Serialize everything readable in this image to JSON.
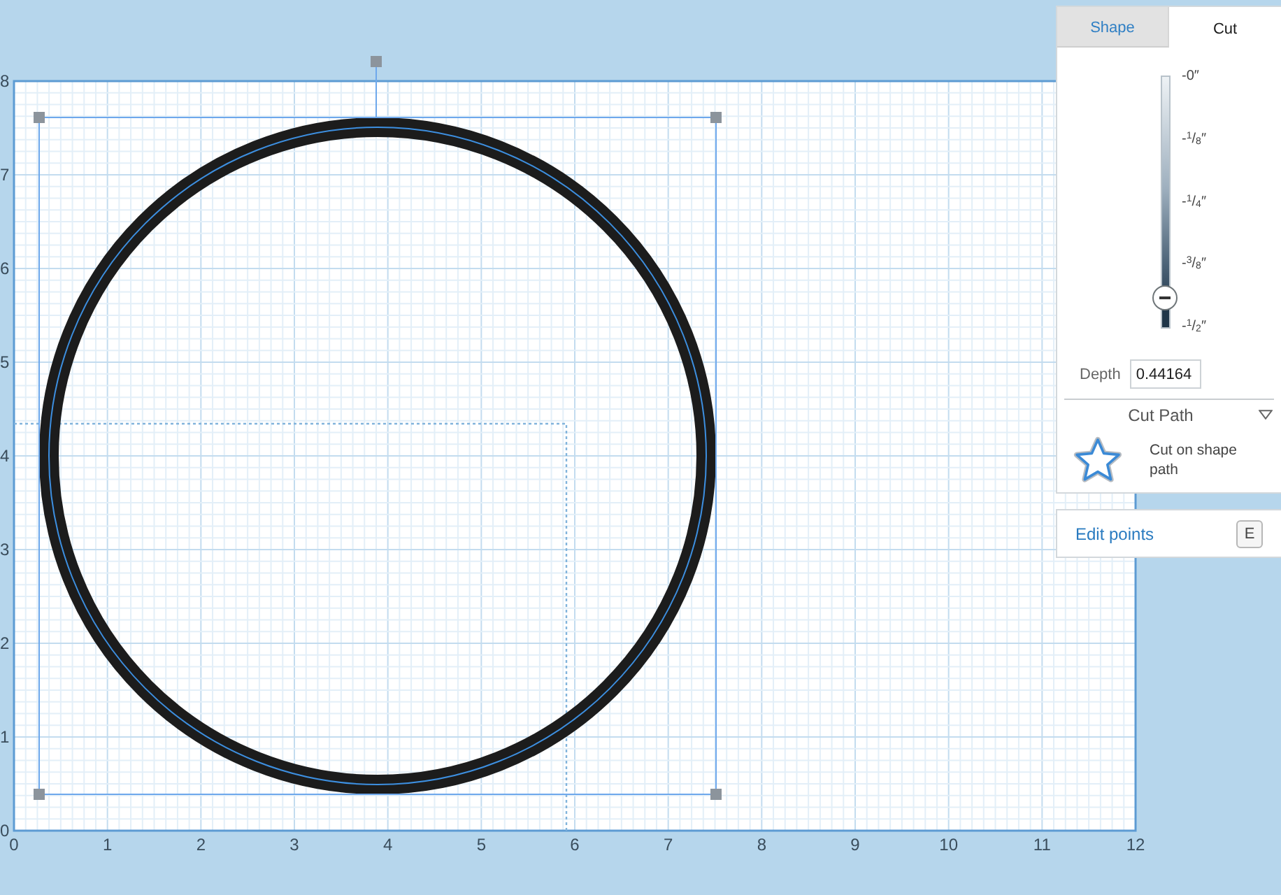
{
  "canvas": {
    "x_ruler": [
      "0",
      "1",
      "2",
      "3",
      "4",
      "5",
      "6",
      "7",
      "8",
      "9",
      "10",
      "11",
      "12"
    ],
    "y_ruler": [
      "8",
      "7",
      "6",
      "5",
      "4",
      "3",
      "2",
      "1",
      "0"
    ]
  },
  "panel": {
    "tabs": [
      {
        "label": "Shape",
        "selected": false
      },
      {
        "label": "Cut",
        "selected": true
      }
    ],
    "depth_slider": {
      "marks": [
        "-0″",
        "-$^{1}$/$_{8}$″",
        "-$^{1}$/$_{4}$″",
        "-$^{3}$/$_{8}$″",
        "-$^{1}$/$_{2}$″"
      ],
      "level": 0.88
    },
    "depth": {
      "label": "Depth",
      "value": "0.44164"
    },
    "cut_path": {
      "title": "Cut Path",
      "option": "Cut on shape path"
    }
  },
  "edit_points": {
    "label": "Edit points",
    "shortcut": "E"
  }
}
